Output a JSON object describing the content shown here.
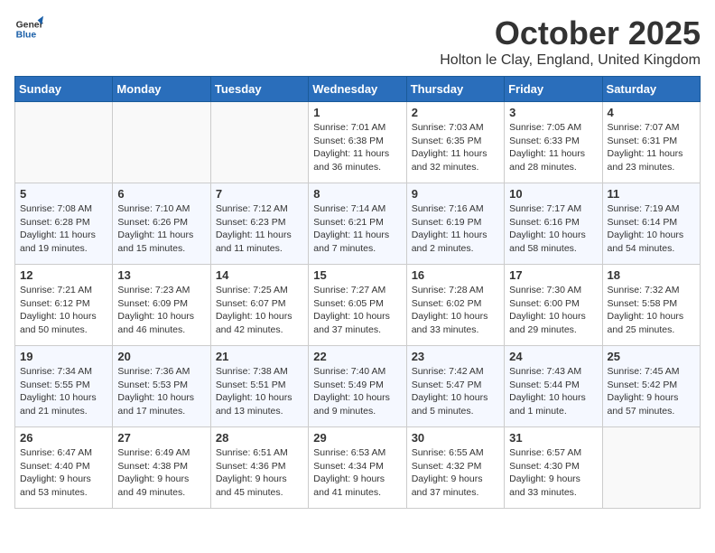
{
  "logo": {
    "line1": "General",
    "line2": "Blue"
  },
  "title": "October 2025",
  "location": "Holton le Clay, England, United Kingdom",
  "days_header": [
    "Sunday",
    "Monday",
    "Tuesday",
    "Wednesday",
    "Thursday",
    "Friday",
    "Saturday"
  ],
  "weeks": [
    [
      {
        "day": "",
        "info": ""
      },
      {
        "day": "",
        "info": ""
      },
      {
        "day": "",
        "info": ""
      },
      {
        "day": "1",
        "info": "Sunrise: 7:01 AM\nSunset: 6:38 PM\nDaylight: 11 hours\nand 36 minutes."
      },
      {
        "day": "2",
        "info": "Sunrise: 7:03 AM\nSunset: 6:35 PM\nDaylight: 11 hours\nand 32 minutes."
      },
      {
        "day": "3",
        "info": "Sunrise: 7:05 AM\nSunset: 6:33 PM\nDaylight: 11 hours\nand 28 minutes."
      },
      {
        "day": "4",
        "info": "Sunrise: 7:07 AM\nSunset: 6:31 PM\nDaylight: 11 hours\nand 23 minutes."
      }
    ],
    [
      {
        "day": "5",
        "info": "Sunrise: 7:08 AM\nSunset: 6:28 PM\nDaylight: 11 hours\nand 19 minutes."
      },
      {
        "day": "6",
        "info": "Sunrise: 7:10 AM\nSunset: 6:26 PM\nDaylight: 11 hours\nand 15 minutes."
      },
      {
        "day": "7",
        "info": "Sunrise: 7:12 AM\nSunset: 6:23 PM\nDaylight: 11 hours\nand 11 minutes."
      },
      {
        "day": "8",
        "info": "Sunrise: 7:14 AM\nSunset: 6:21 PM\nDaylight: 11 hours\nand 7 minutes."
      },
      {
        "day": "9",
        "info": "Sunrise: 7:16 AM\nSunset: 6:19 PM\nDaylight: 11 hours\nand 2 minutes."
      },
      {
        "day": "10",
        "info": "Sunrise: 7:17 AM\nSunset: 6:16 PM\nDaylight: 10 hours\nand 58 minutes."
      },
      {
        "day": "11",
        "info": "Sunrise: 7:19 AM\nSunset: 6:14 PM\nDaylight: 10 hours\nand 54 minutes."
      }
    ],
    [
      {
        "day": "12",
        "info": "Sunrise: 7:21 AM\nSunset: 6:12 PM\nDaylight: 10 hours\nand 50 minutes."
      },
      {
        "day": "13",
        "info": "Sunrise: 7:23 AM\nSunset: 6:09 PM\nDaylight: 10 hours\nand 46 minutes."
      },
      {
        "day": "14",
        "info": "Sunrise: 7:25 AM\nSunset: 6:07 PM\nDaylight: 10 hours\nand 42 minutes."
      },
      {
        "day": "15",
        "info": "Sunrise: 7:27 AM\nSunset: 6:05 PM\nDaylight: 10 hours\nand 37 minutes."
      },
      {
        "day": "16",
        "info": "Sunrise: 7:28 AM\nSunset: 6:02 PM\nDaylight: 10 hours\nand 33 minutes."
      },
      {
        "day": "17",
        "info": "Sunrise: 7:30 AM\nSunset: 6:00 PM\nDaylight: 10 hours\nand 29 minutes."
      },
      {
        "day": "18",
        "info": "Sunrise: 7:32 AM\nSunset: 5:58 PM\nDaylight: 10 hours\nand 25 minutes."
      }
    ],
    [
      {
        "day": "19",
        "info": "Sunrise: 7:34 AM\nSunset: 5:55 PM\nDaylight: 10 hours\nand 21 minutes."
      },
      {
        "day": "20",
        "info": "Sunrise: 7:36 AM\nSunset: 5:53 PM\nDaylight: 10 hours\nand 17 minutes."
      },
      {
        "day": "21",
        "info": "Sunrise: 7:38 AM\nSunset: 5:51 PM\nDaylight: 10 hours\nand 13 minutes."
      },
      {
        "day": "22",
        "info": "Sunrise: 7:40 AM\nSunset: 5:49 PM\nDaylight: 10 hours\nand 9 minutes."
      },
      {
        "day": "23",
        "info": "Sunrise: 7:42 AM\nSunset: 5:47 PM\nDaylight: 10 hours\nand 5 minutes."
      },
      {
        "day": "24",
        "info": "Sunrise: 7:43 AM\nSunset: 5:44 PM\nDaylight: 10 hours\nand 1 minute."
      },
      {
        "day": "25",
        "info": "Sunrise: 7:45 AM\nSunset: 5:42 PM\nDaylight: 9 hours\nand 57 minutes."
      }
    ],
    [
      {
        "day": "26",
        "info": "Sunrise: 6:47 AM\nSunset: 4:40 PM\nDaylight: 9 hours\nand 53 minutes."
      },
      {
        "day": "27",
        "info": "Sunrise: 6:49 AM\nSunset: 4:38 PM\nDaylight: 9 hours\nand 49 minutes."
      },
      {
        "day": "28",
        "info": "Sunrise: 6:51 AM\nSunset: 4:36 PM\nDaylight: 9 hours\nand 45 minutes."
      },
      {
        "day": "29",
        "info": "Sunrise: 6:53 AM\nSunset: 4:34 PM\nDaylight: 9 hours\nand 41 minutes."
      },
      {
        "day": "30",
        "info": "Sunrise: 6:55 AM\nSunset: 4:32 PM\nDaylight: 9 hours\nand 37 minutes."
      },
      {
        "day": "31",
        "info": "Sunrise: 6:57 AM\nSunset: 4:30 PM\nDaylight: 9 hours\nand 33 minutes."
      },
      {
        "day": "",
        "info": ""
      }
    ]
  ]
}
